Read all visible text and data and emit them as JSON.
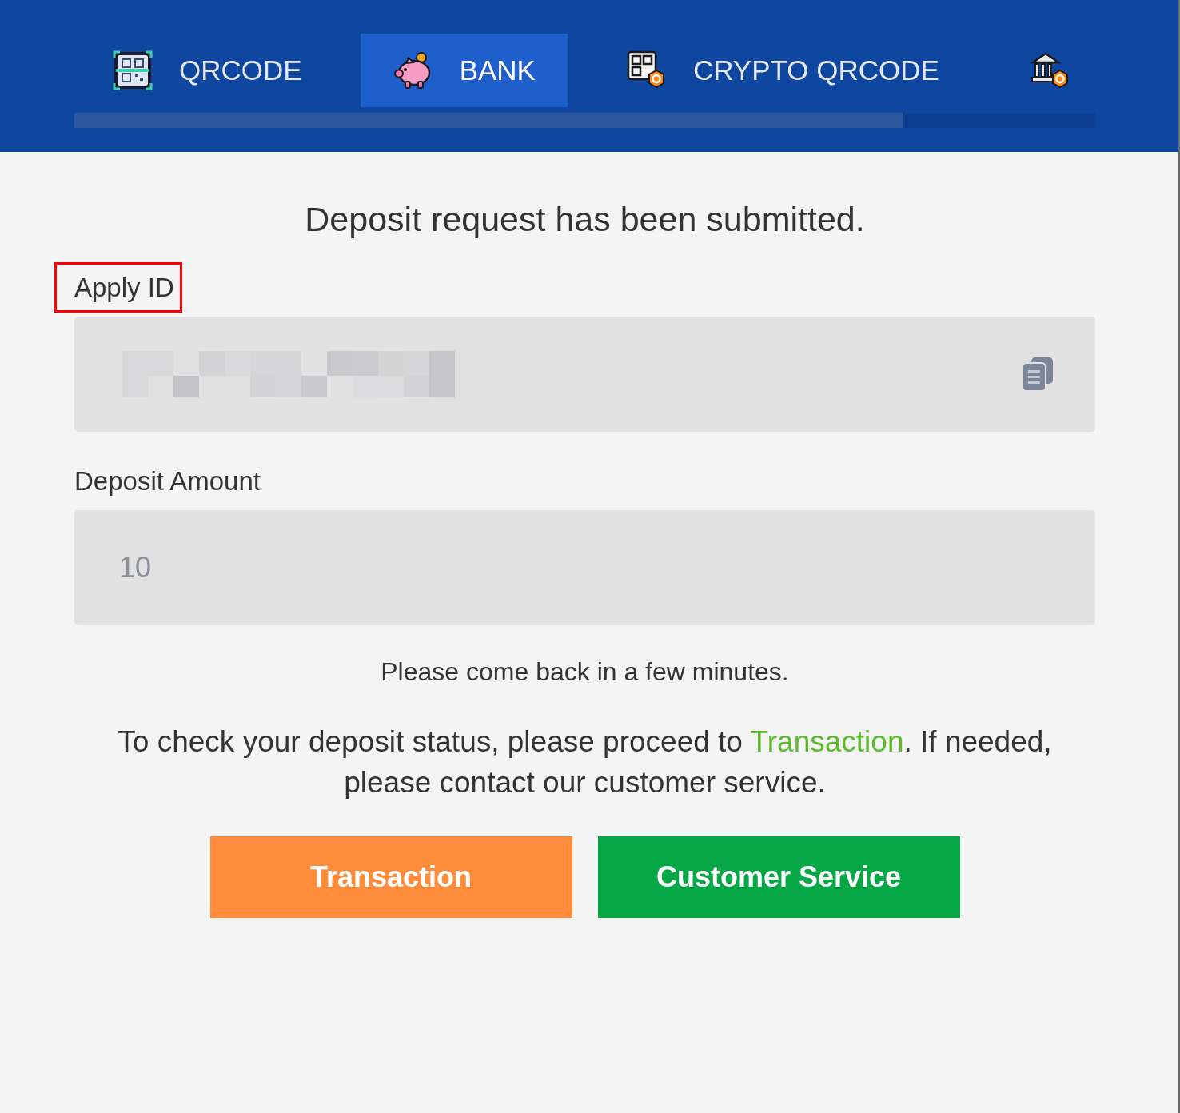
{
  "tabs": [
    {
      "kind": "qr",
      "label": "QRCODE",
      "selected": false
    },
    {
      "kind": "piggy",
      "label": "BANK",
      "selected": true
    },
    {
      "kind": "cryptoqr",
      "label": "CRYPTO QRCODE",
      "selected": false
    },
    {
      "kind": "cryptobank",
      "selected": false
    }
  ],
  "heading": "Deposit request has been submitted.",
  "fields": [
    {
      "label": "Apply ID",
      "highlighted": true,
      "kind": "masked",
      "copyable": true
    },
    {
      "label": "Deposit Amount",
      "highlighted": false,
      "kind": "text",
      "value": "10",
      "copyable": false
    }
  ],
  "note": "Please come back in a few minutes.",
  "message": {
    "before": "To check your deposit status, please proceed to ",
    "link": "Transaction",
    "after": ". If needed, please contact our customer service."
  },
  "buttons": [
    {
      "label": "Transaction",
      "color": "#ff8c3a"
    },
    {
      "label": "Customer Service",
      "color": "#05a845"
    }
  ]
}
